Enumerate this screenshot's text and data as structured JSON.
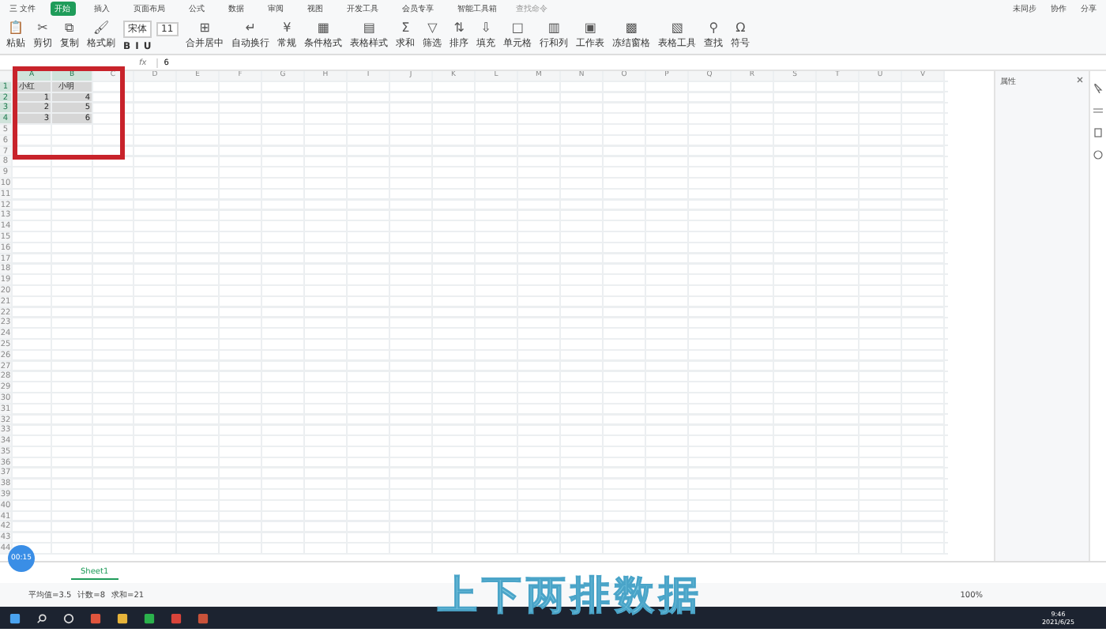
{
  "menu": {
    "file": "三 文件",
    "tabs": [
      {
        "label": "开始",
        "selected": true
      },
      {
        "label": "插入",
        "selected": false
      },
      {
        "label": "页面布局",
        "selected": false
      },
      {
        "label": "公式",
        "selected": false
      },
      {
        "label": "数据",
        "selected": false
      },
      {
        "label": "审阅",
        "selected": false
      },
      {
        "label": "视图",
        "selected": false
      },
      {
        "label": "开发工具",
        "selected": false
      },
      {
        "label": "会员专享",
        "selected": false
      },
      {
        "label": "智能工具箱",
        "selected": false
      }
    ],
    "search": "查找命令",
    "right": [
      "未同步",
      "协作",
      "分享"
    ]
  },
  "ribbon": {
    "left": [
      {
        "glyph": "📋",
        "label": "粘贴"
      },
      {
        "glyph": "✂",
        "label": "剪切"
      },
      {
        "glyph": "⧉",
        "label": "复制"
      },
      {
        "glyph": "🖌",
        "label": "格式刷"
      }
    ],
    "font": {
      "name": "宋体",
      "size": "11",
      "styles": [
        "B",
        "I",
        "U"
      ]
    },
    "tools": [
      {
        "glyph": "⊞",
        "label": "合并居中"
      },
      {
        "glyph": "↵",
        "label": "自动换行"
      },
      {
        "glyph": "¥",
        "label": "常规"
      },
      {
        "glyph": "▦",
        "label": "条件格式"
      },
      {
        "glyph": "▤",
        "label": "表格样式"
      },
      {
        "glyph": "Σ",
        "label": "求和"
      },
      {
        "glyph": "▽",
        "label": "筛选"
      },
      {
        "glyph": "⇅",
        "label": "排序"
      },
      {
        "glyph": "⇩",
        "label": "填充"
      },
      {
        "glyph": "□",
        "label": "单元格"
      },
      {
        "glyph": "▥",
        "label": "行和列"
      },
      {
        "glyph": "▣",
        "label": "工作表"
      },
      {
        "glyph": "▩",
        "label": "冻结窗格"
      },
      {
        "glyph": "▧",
        "label": "表格工具"
      },
      {
        "glyph": "⚲",
        "label": "查找"
      },
      {
        "glyph": "Ω",
        "label": "符号"
      }
    ]
  },
  "formula_bar": {
    "fx": "fx",
    "value": "6"
  },
  "grid": {
    "columns": [
      "A",
      "B",
      "C",
      "D",
      "E",
      "F",
      "G",
      "H",
      "I",
      "J",
      "K",
      "L",
      "M",
      "N",
      "O",
      "P",
      "Q",
      "R",
      "S",
      "T",
      "U",
      "V"
    ],
    "row_headers": [
      "1",
      "2",
      "3",
      "4",
      "5",
      "6",
      "7",
      "8",
      "9",
      "10",
      "11",
      "12",
      "13",
      "14",
      "15",
      "16",
      "17",
      "18",
      "19",
      "20",
      "21",
      "22",
      "23",
      "24",
      "25",
      "26",
      "27",
      "28",
      "29",
      "30",
      "31",
      "32",
      "33",
      "34",
      "35",
      "36",
      "37",
      "38",
      "39",
      "40",
      "41",
      "42",
      "43",
      "44"
    ],
    "rows": [
      {
        "cells": [
          "小红",
          "小明"
        ],
        "selected": true
      },
      {
        "cells": [
          "1",
          "4"
        ],
        "selected": true
      },
      {
        "cells": [
          "2",
          "5"
        ],
        "selected": true
      },
      {
        "cells": [
          "3",
          "6"
        ],
        "selected": true
      }
    ]
  },
  "side_panel": {
    "title": "属性"
  },
  "sheet_tabs": [
    {
      "label": "Sheet1",
      "selected": true
    }
  ],
  "status": {
    "summary": [
      "平均值=3.5",
      "计数=8",
      "求和=21"
    ],
    "zoom": "100%"
  },
  "taskbar": {
    "time": "9:46",
    "date": "2021/6/25"
  },
  "video": {
    "timer": "00:15",
    "subtitle": "上下两排数据"
  }
}
